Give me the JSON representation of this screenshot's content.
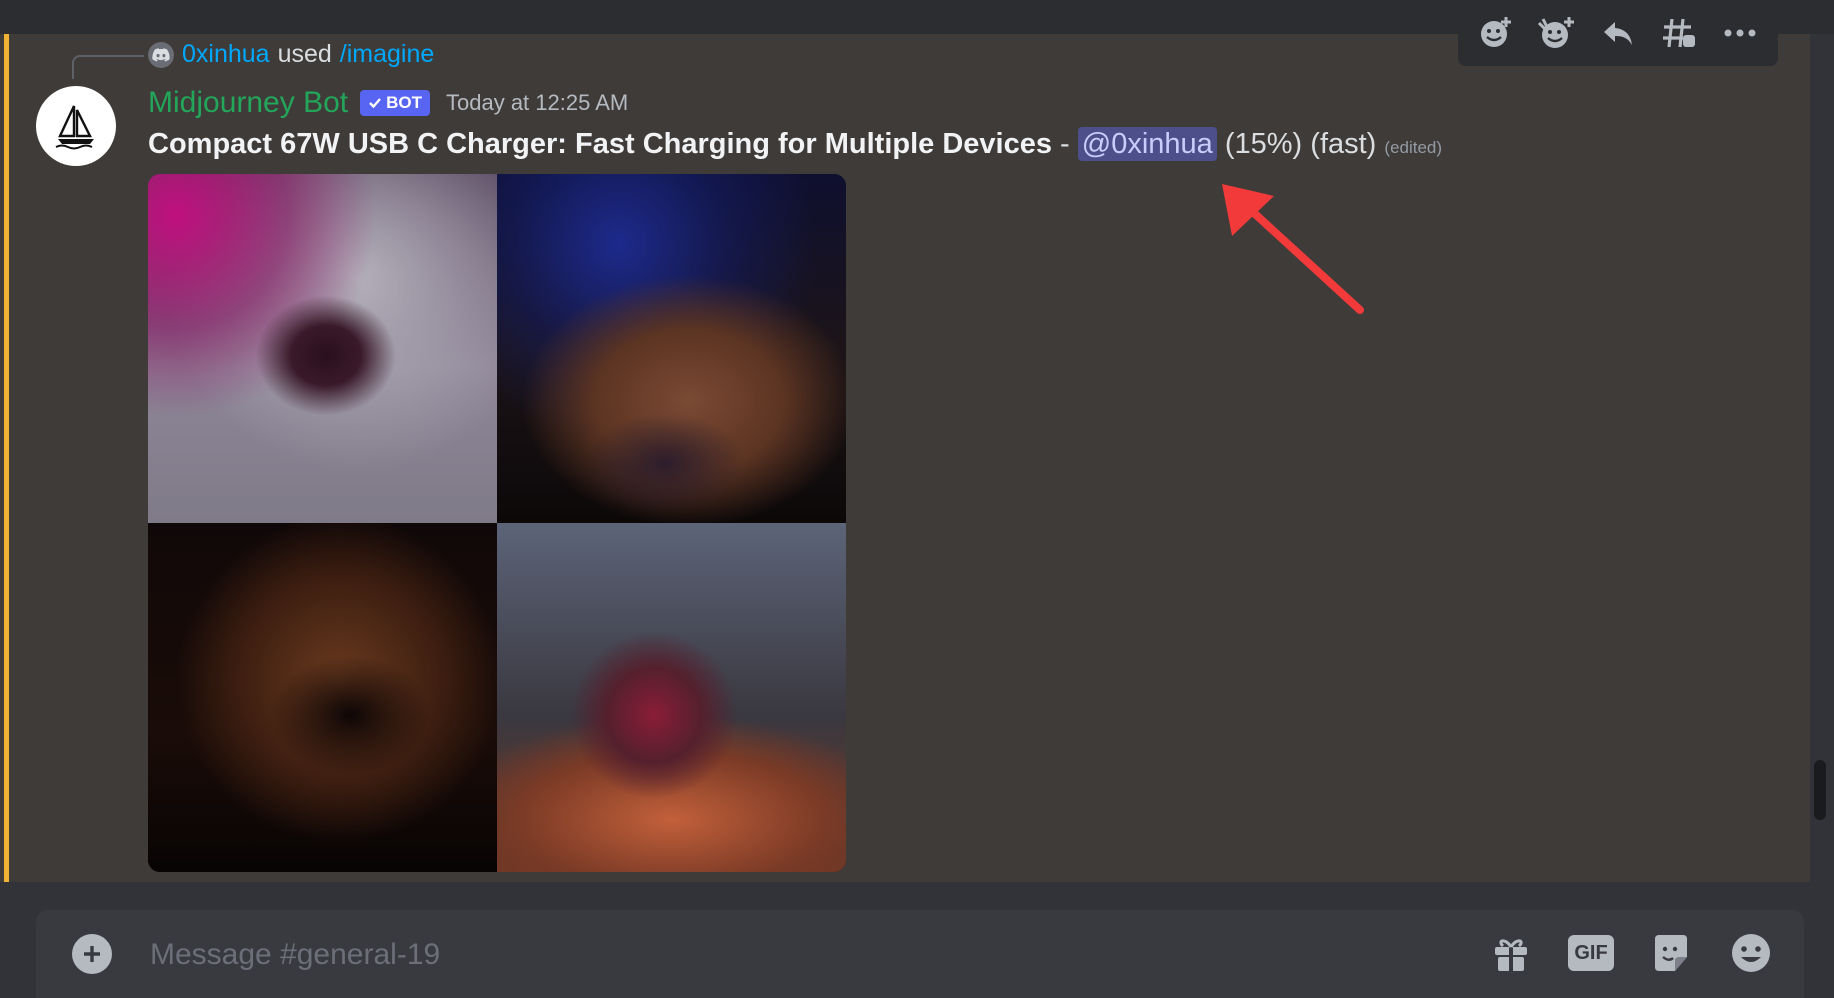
{
  "reply": {
    "user": "0xinhua",
    "used_text": "used",
    "command": "/imagine"
  },
  "message": {
    "author": "Midjourney Bot",
    "bot_tag": "BOT",
    "timestamp": "Today at 12:25 AM",
    "title": "Compact 67W USB C Charger: Fast Charging for Multiple Devices",
    "separator": " - ",
    "mention": "@0xinhua",
    "progress": "(15%)",
    "mode": "(fast)",
    "edited": "(edited)",
    "image_tiles": 4
  },
  "composer": {
    "placeholder": "Message #general-19",
    "gif_label": "GIF"
  },
  "colors": {
    "author_green": "#23a55a",
    "link_blue": "#00a8fc",
    "bot_tag": "#5865f2",
    "mention_bg": "#4c4f8a",
    "highlight_bar": "#f0b232",
    "annotation_arrow": "#f23a3a"
  },
  "icons": {
    "toolbar": [
      "add-reaction-icon",
      "add-super-reaction-icon",
      "reply-icon",
      "create-thread-icon",
      "more-icon"
    ],
    "composer": [
      "plus-icon",
      "gift-icon",
      "gif-icon",
      "sticker-icon",
      "emoji-icon"
    ],
    "avatar": "sailboat-icon",
    "reply_avatar": "discord-icon"
  }
}
